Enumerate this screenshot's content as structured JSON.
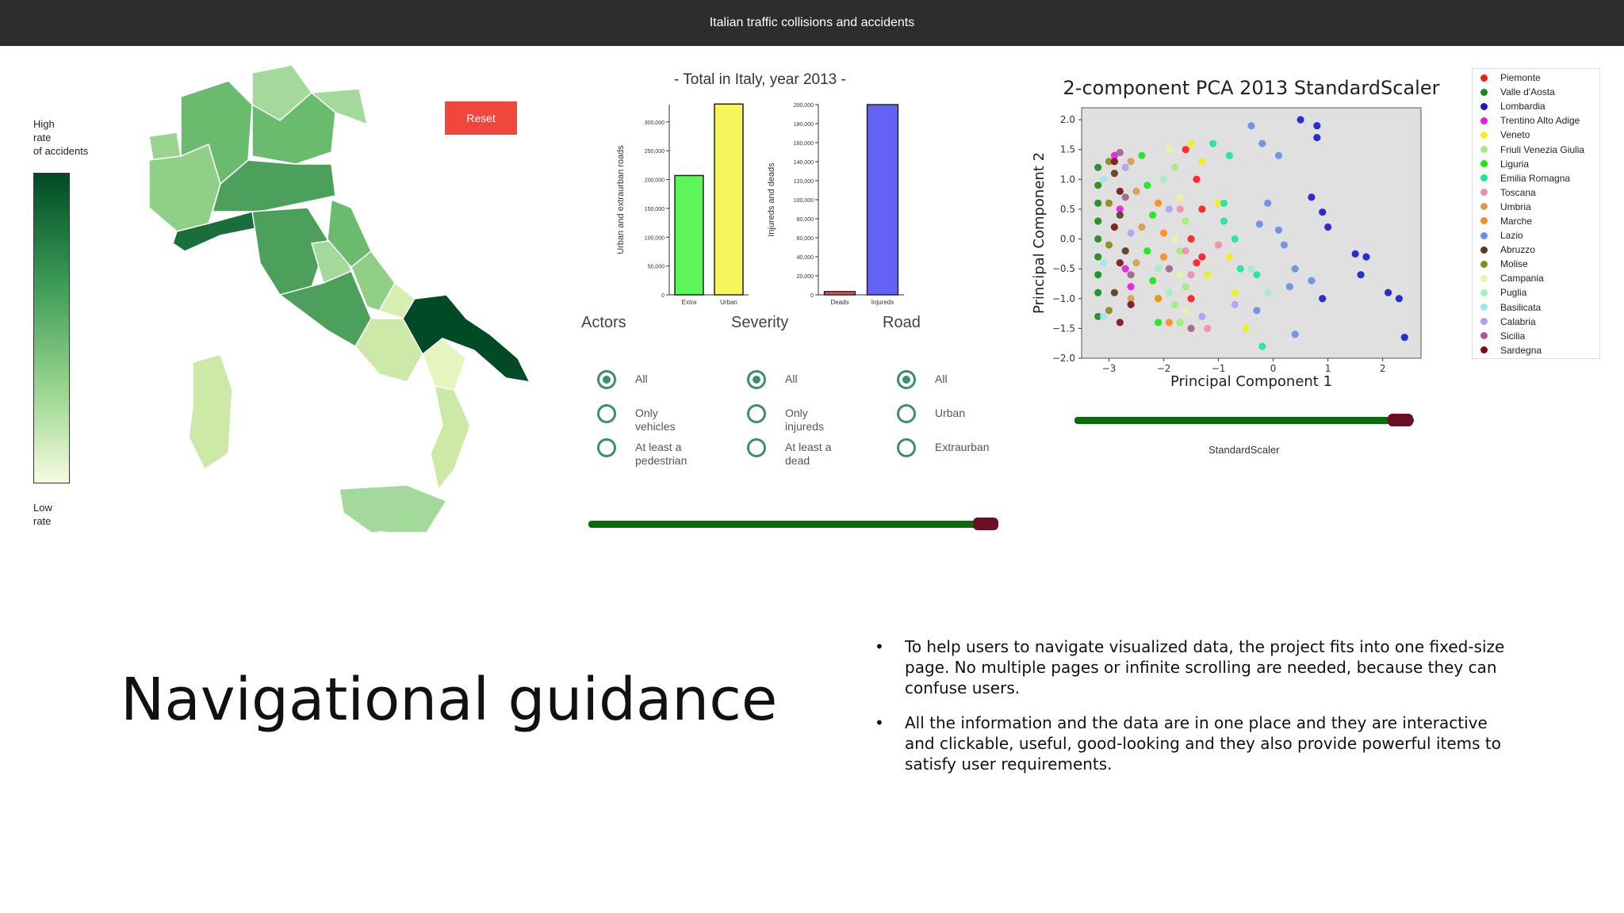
{
  "header": {
    "title": "Italian traffic collisions and accidents"
  },
  "map_legend": {
    "high_label": "High\nrate\nof accidents",
    "low_label": "Low\nrate"
  },
  "reset": {
    "label": "Reset"
  },
  "bar_charts": {
    "title": "- Total in Italy, year 2013 -",
    "chart_data": [
      {
        "type": "bar",
        "categories": [
          "Extra",
          "Urban"
        ],
        "values": [
          207000,
          331000
        ],
        "colors": [
          "#5cf55c",
          "#f5f55c"
        ],
        "ylabel": "Urban and extraurban roads",
        "ylim": [
          0,
          330000
        ],
        "yticks": [
          "0",
          "50,000",
          "100,000",
          "150,000",
          "200,000",
          "250,000",
          "300,000"
        ],
        "ytick_values": [
          0,
          50000,
          100000,
          150000,
          200000,
          250000,
          300000
        ]
      },
      {
        "type": "bar",
        "categories": [
          "Deads",
          "Injureds"
        ],
        "values": [
          3400,
          200000
        ],
        "colors": [
          "#e85555",
          "#6262f5"
        ],
        "ylabel": "Injureds and deads",
        "ylim": [
          0,
          200000
        ],
        "yticks": [
          "0",
          "20,000",
          "40,000",
          "60,000",
          "80,000",
          "100,000",
          "120,000",
          "140,000",
          "160,000",
          "180,000",
          "200,000"
        ],
        "ytick_values": [
          0,
          20000,
          40000,
          60000,
          80000,
          100000,
          120000,
          140000,
          160000,
          180000,
          200000
        ]
      }
    ]
  },
  "filters": {
    "actors": {
      "title": "Actors",
      "options": [
        "All",
        "Only vehicles",
        "At least a pedestrian"
      ],
      "selected": 0
    },
    "severity": {
      "title": "Severity",
      "options": [
        "All",
        "Only injureds",
        "At least a dead"
      ],
      "selected": 0
    },
    "road": {
      "title": "Road",
      "options": [
        "All",
        "Urban",
        "Extraurban"
      ],
      "selected": 0
    }
  },
  "year_slider": {
    "position": 0.97
  },
  "pca": {
    "title": "2-component PCA 2013 StandardScaler",
    "chart_data": {
      "type": "scatter",
      "title": "2-component PCA 2013 StandardScaler",
      "xlabel": "Principal Component 1",
      "ylabel": "Principal Component 2",
      "xlim": [
        -3.5,
        2.7
      ],
      "ylim": [
        -2.0,
        2.2
      ],
      "xticks": [
        -3,
        -2,
        -1,
        0,
        1,
        2
      ],
      "yticks": [
        -2.0,
        -1.5,
        -1.0,
        -0.5,
        0.0,
        0.5,
        1.0,
        1.5,
        2.0
      ],
      "background": "#e0e0e0",
      "series": [
        {
          "name": "Piemonte",
          "color": "#ff1a1a",
          "points": [
            [
              -1.6,
              1.5
            ],
            [
              -1.4,
              1.0
            ],
            [
              -1.3,
              0.5
            ],
            [
              -1.5,
              0.0
            ],
            [
              -1.4,
              -0.4
            ],
            [
              -1.5,
              -1.0
            ],
            [
              -1.3,
              -0.3
            ]
          ]
        },
        {
          "name": "Valle d'Aosta",
          "color": "#1a8a1a",
          "points": [
            [
              -3.2,
              1.2
            ],
            [
              -3.2,
              0.9
            ],
            [
              -3.2,
              0.6
            ],
            [
              -3.2,
              0.3
            ],
            [
              -3.2,
              0.0
            ],
            [
              -3.2,
              -0.3
            ],
            [
              -3.2,
              -0.6
            ],
            [
              -3.2,
              -0.9
            ],
            [
              -3.2,
              -1.3
            ]
          ]
        },
        {
          "name": "Lombardia",
          "color": "#1a1acc",
          "points": [
            [
              0.5,
              2.0
            ],
            [
              0.8,
              1.9
            ],
            [
              0.8,
              1.7
            ],
            [
              0.7,
              0.7
            ],
            [
              0.9,
              0.45
            ],
            [
              1.0,
              0.2
            ],
            [
              1.5,
              -0.25
            ],
            [
              1.7,
              -0.3
            ],
            [
              1.6,
              -0.6
            ],
            [
              2.1,
              -0.9
            ],
            [
              2.3,
              -1.0
            ],
            [
              2.4,
              -1.65
            ],
            [
              0.9,
              -1.0
            ]
          ]
        },
        {
          "name": "Trentino Alto Adige",
          "color": "#e61ae6",
          "points": [
            [
              -2.9,
              1.4
            ],
            [
              -2.8,
              0.5
            ],
            [
              -2.7,
              -0.5
            ],
            [
              -2.6,
              -0.8
            ]
          ]
        },
        {
          "name": "Veneto",
          "color": "#f0f01a",
          "points": [
            [
              -1.5,
              1.6
            ],
            [
              -1.3,
              1.3
            ],
            [
              -1.0,
              0.6
            ],
            [
              -0.8,
              -0.3
            ],
            [
              -0.7,
              -0.9
            ],
            [
              -0.5,
              -1.5
            ],
            [
              -1.2,
              -0.6
            ]
          ]
        },
        {
          "name": "Friuli Venezia Giulia",
          "color": "#a0f07a",
          "points": [
            [
              -1.8,
              1.2
            ],
            [
              -1.6,
              0.3
            ],
            [
              -1.7,
              -0.2
            ],
            [
              -1.6,
              -0.8
            ],
            [
              -1.8,
              -1.1
            ],
            [
              -1.7,
              -1.4
            ]
          ]
        },
        {
          "name": "Liguria",
          "color": "#1ae61a",
          "points": [
            [
              -2.4,
              1.4
            ],
            [
              -2.3,
              0.9
            ],
            [
              -2.2,
              0.4
            ],
            [
              -2.3,
              -0.2
            ],
            [
              -2.2,
              -0.7
            ],
            [
              -2.1,
              -1.0
            ],
            [
              -2.1,
              -1.4
            ]
          ]
        },
        {
          "name": "Emilia Romagna",
          "color": "#1ae6a0",
          "points": [
            [
              -1.1,
              1.6
            ],
            [
              -0.8,
              1.4
            ],
            [
              -0.9,
              0.6
            ],
            [
              -0.9,
              0.3
            ],
            [
              -0.7,
              0.0
            ],
            [
              -0.6,
              -0.5
            ],
            [
              -0.3,
              -0.6
            ],
            [
              -0.2,
              -1.8
            ]
          ]
        },
        {
          "name": "Toscana",
          "color": "#f08cb0",
          "points": [
            [
              -1.7,
              0.5
            ],
            [
              -1.6,
              -0.2
            ],
            [
              -1.5,
              -0.6
            ],
            [
              -1.2,
              -1.5
            ],
            [
              -1.0,
              -0.1
            ]
          ]
        },
        {
          "name": "Umbria",
          "color": "#d4a04a",
          "points": [
            [
              -2.6,
              1.3
            ],
            [
              -2.5,
              0.8
            ],
            [
              -2.4,
              0.2
            ],
            [
              -2.5,
              -0.4
            ],
            [
              -2.6,
              -1.0
            ]
          ]
        },
        {
          "name": "Marche",
          "color": "#ff8c1a",
          "points": [
            [
              -2.1,
              0.6
            ],
            [
              -2.0,
              0.1
            ],
            [
              -2.0,
              -0.3
            ],
            [
              -1.9,
              -1.4
            ],
            [
              -2.1,
              -1.0
            ]
          ]
        },
        {
          "name": "Lazio",
          "color": "#6a8ce6",
          "points": [
            [
              -0.4,
              1.9
            ],
            [
              -0.2,
              1.6
            ],
            [
              0.1,
              1.4
            ],
            [
              -0.1,
              0.6
            ],
            [
              -0.25,
              0.25
            ],
            [
              0.1,
              0.15
            ],
            [
              0.3,
              -0.8
            ],
            [
              0.4,
              -0.5
            ],
            [
              0.7,
              -0.7
            ],
            [
              0.4,
              -1.6
            ],
            [
              0.2,
              -0.1
            ],
            [
              -0.3,
              -1.2
            ]
          ]
        },
        {
          "name": "Abruzzo",
          "color": "#5a3a1a",
          "points": [
            [
              -2.9,
              1.1
            ],
            [
              -2.8,
              0.4
            ],
            [
              -2.7,
              -0.2
            ],
            [
              -2.9,
              -0.9
            ]
          ]
        },
        {
          "name": "Molise",
          "color": "#8a8a1a",
          "points": [
            [
              -3.0,
              1.3
            ],
            [
              -3.0,
              0.6
            ],
            [
              -3.0,
              -0.1
            ],
            [
              -3.0,
              -1.2
            ]
          ]
        },
        {
          "name": "Campania",
          "color": "#e6f5a0",
          "points": [
            [
              -1.9,
              1.5
            ],
            [
              -1.7,
              0.7
            ],
            [
              -1.8,
              0.0
            ],
            [
              -1.7,
              -0.6
            ],
            [
              -1.6,
              -1.2
            ]
          ]
        },
        {
          "name": "Puglia",
          "color": "#a0f0c0",
          "points": [
            [
              -2.0,
              1.0
            ],
            [
              -2.1,
              -0.5
            ],
            [
              -1.9,
              -0.9
            ],
            [
              -0.4,
              -0.5
            ],
            [
              -0.1,
              -0.9
            ]
          ]
        },
        {
          "name": "Basilicata",
          "color": "#a0e6f0",
          "points": [
            [
              -3.1,
              1.0
            ],
            [
              -3.1,
              -0.4
            ],
            [
              -3.1,
              -1.3
            ]
          ]
        },
        {
          "name": "Calabria",
          "color": "#b0a0f0",
          "points": [
            [
              -2.7,
              1.2
            ],
            [
              -2.6,
              0.1
            ],
            [
              -1.9,
              0.5
            ],
            [
              -1.3,
              -1.3
            ],
            [
              -0.7,
              -1.1
            ]
          ]
        },
        {
          "name": "Sicilia",
          "color": "#a0608a",
          "points": [
            [
              -2.8,
              1.45
            ],
            [
              -2.7,
              0.7
            ],
            [
              -2.6,
              -0.6
            ],
            [
              -1.9,
              -0.5
            ],
            [
              -1.5,
              -1.5
            ]
          ]
        },
        {
          "name": "Sardegna",
          "color": "#7a0f1a",
          "points": [
            [
              -2.9,
              1.3
            ],
            [
              -2.8,
              0.8
            ],
            [
              -2.9,
              0.2
            ],
            [
              -2.8,
              -0.4
            ],
            [
              -2.6,
              -1.1
            ],
            [
              -2.8,
              -1.4
            ]
          ]
        }
      ]
    }
  },
  "pca_slider": {
    "position": 0.96,
    "label": "StandardScaler"
  },
  "slide": {
    "title": "Navigational guidance",
    "bullets": [
      "To help users to navigate visualized data, the project fits into one fixed-size page. No multiple pages or infinite scrolling are needed, because they can confuse users.",
      "All the information and the data are in one place and they are interactive and clickable, useful, good-looking and they also provide powerful items to satisfy user requirements."
    ]
  }
}
